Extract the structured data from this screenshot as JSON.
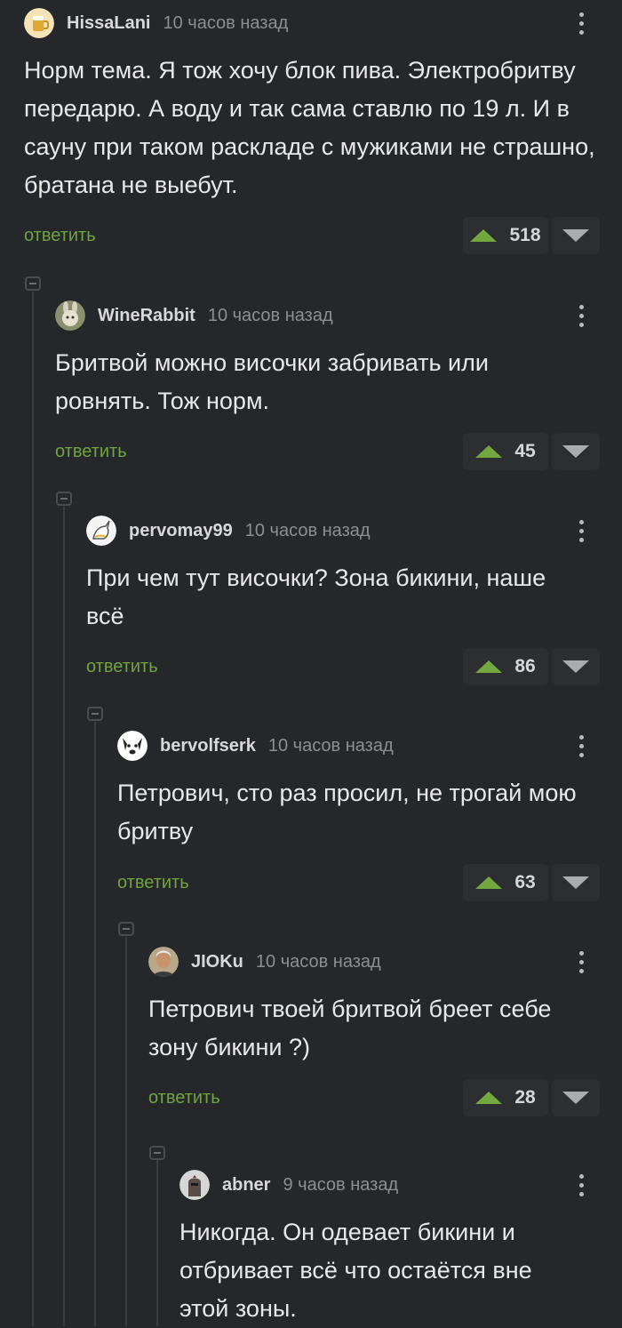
{
  "comments": [
    {
      "username": "HissaLani",
      "time": "10 часов назад",
      "text": "Норм тема. Я тож хочу блок пива. Электробритву передарю. А воду и так сама ставлю по 19 л. И в сауну при таком раскладе с мужиками не страшно, братана не выебут.",
      "reply_label": "ответить",
      "votes": "518",
      "avatar_icon": "beer-glass-avatar"
    },
    {
      "username": "WineRabbit",
      "time": "10 часов назад",
      "text": "Бритвой можно височки забривать или ровнять. Тож норм.",
      "reply_label": "ответить",
      "votes": "45",
      "avatar_icon": "rabbit-avatar"
    },
    {
      "username": "pervomay99",
      "time": "10 часов назад",
      "text": "При чем тут височки? Зона бикини, наше всё",
      "reply_label": "ответить",
      "votes": "86",
      "avatar_icon": "unicorn-avatar"
    },
    {
      "username": "bervolfserk",
      "time": "10 часов назад",
      "text": "Петрович, сто раз просил, не трогай мою бритву",
      "reply_label": "ответить",
      "votes": "63",
      "avatar_icon": "dog-avatar"
    },
    {
      "username": "JIOKu",
      "time": "10 часов назад",
      "text": "Петрович твоей бритвой бреет себе зону бикини ?)",
      "reply_label": "ответить",
      "votes": "28",
      "avatar_icon": "man-portrait-avatar"
    },
    {
      "username": "abner",
      "time": "9 часов назад",
      "text": "Никогда. Он одевает бикини и отбривает всё что остаётся вне этой зоны.",
      "avatar_icon": "knight-avatar"
    }
  ],
  "colors": {
    "background": "#25272b",
    "accent_green": "#72a83e",
    "reply_green": "#6fa43e",
    "muted_text": "#8c8e93"
  }
}
